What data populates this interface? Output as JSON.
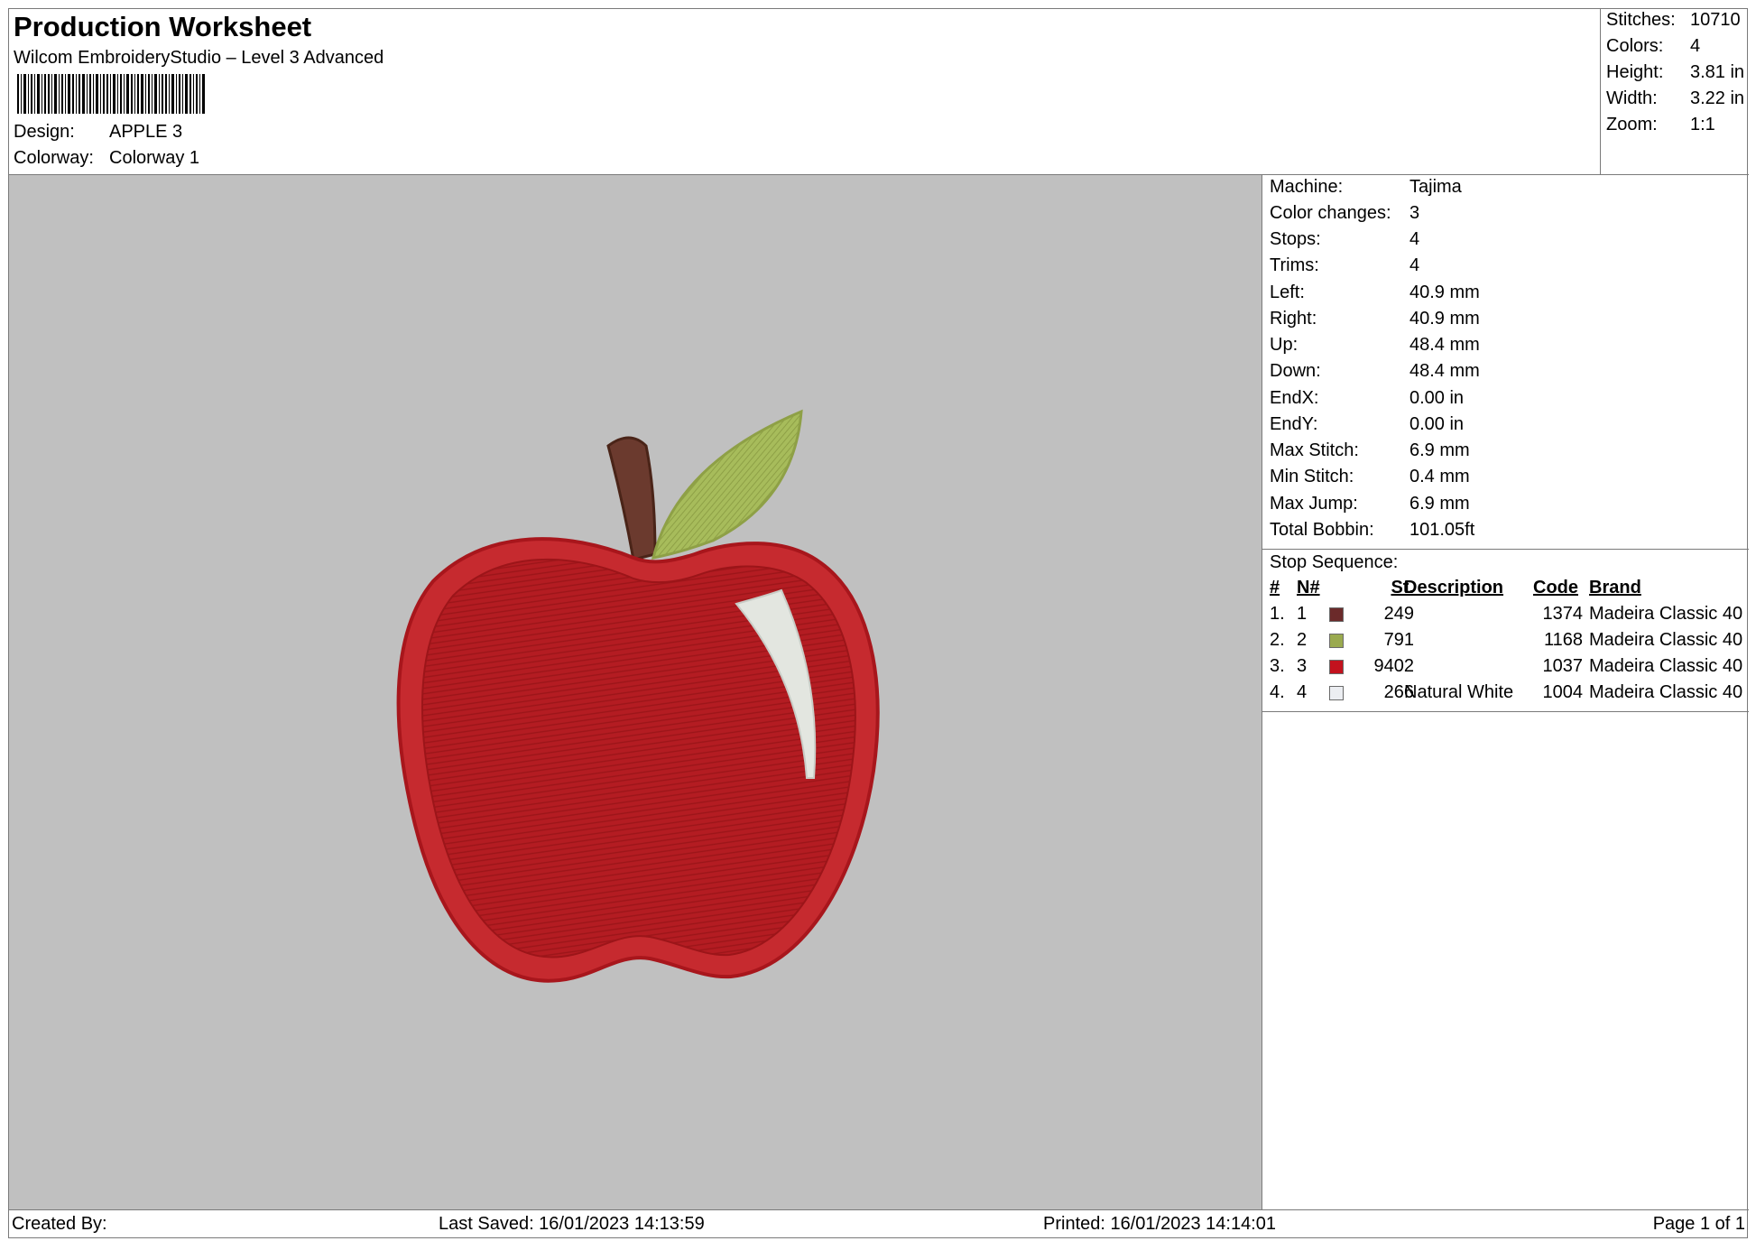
{
  "header": {
    "title": "Production Worksheet",
    "subtitle": "Wilcom EmbroideryStudio – Level 3 Advanced",
    "design_label": "Design:",
    "design_value": "APPLE 3",
    "colorway_label": "Colorway:",
    "colorway_value": "Colorway 1"
  },
  "stats": [
    {
      "label": "Stitches:",
      "value": "10710"
    },
    {
      "label": "Colors:",
      "value": "4"
    },
    {
      "label": "Height:",
      "value": "3.81 in"
    },
    {
      "label": "Width:",
      "value": "3.22 in"
    },
    {
      "label": "Zoom:",
      "value": "1:1"
    }
  ],
  "properties": [
    {
      "label": "Machine:",
      "value": "Tajima"
    },
    {
      "label": "Color changes:",
      "value": "3"
    },
    {
      "label": "Stops:",
      "value": "4"
    },
    {
      "label": "Trims:",
      "value": "4"
    },
    {
      "label": "Left:",
      "value": "40.9 mm"
    },
    {
      "label": "Right:",
      "value": "40.9 mm"
    },
    {
      "label": "Up:",
      "value": "48.4 mm"
    },
    {
      "label": "Down:",
      "value": "48.4 mm"
    },
    {
      "label": "EndX:",
      "value": "0.00 in"
    },
    {
      "label": "EndY:",
      "value": "0.00 in"
    },
    {
      "label": "Max Stitch:",
      "value": "6.9 mm"
    },
    {
      "label": "Min Stitch:",
      "value": "0.4 mm"
    },
    {
      "label": "Max Jump:",
      "value": "6.9 mm"
    },
    {
      "label": "Total Bobbin:",
      "value": "101.05ft"
    }
  ],
  "sequence": {
    "title": "Stop Sequence:",
    "headers": {
      "index": "#",
      "needle": "N#",
      "stitches": "St.",
      "description": "Description",
      "code": "Code",
      "brand": "Brand"
    },
    "rows": [
      {
        "index": "1.",
        "needle": "1",
        "color": "#6b2a2a",
        "stitches": "249",
        "description": "",
        "code": "1374",
        "brand": "Madeira Classic 40"
      },
      {
        "index": "2.",
        "needle": "2",
        "color": "#9aaa4f",
        "stitches": "791",
        "description": "",
        "code": "1168",
        "brand": "Madeira Classic 40"
      },
      {
        "index": "3.",
        "needle": "3",
        "color": "#c3121e",
        "stitches": "9402",
        "description": "",
        "code": "1037",
        "brand": "Madeira Classic 40"
      },
      {
        "index": "4.",
        "needle": "4",
        "color": "#eceef2",
        "stitches": "266",
        "description": "Natural White",
        "code": "1004",
        "brand": "Madeira Classic 40"
      }
    ]
  },
  "footer": {
    "created": "Created By:",
    "saved": "Last Saved: 16/01/2023 14:13:59",
    "printed": "Printed: 16/01/2023 14:14:01",
    "page": "Page 1 of 1"
  },
  "preview": {
    "background": "#c0c0c0",
    "apple_color": "#c3121e",
    "leaf_color": "#9aaa4f",
    "stem_color": "#6b2a2a",
    "highlight_color": "#eceef2"
  }
}
